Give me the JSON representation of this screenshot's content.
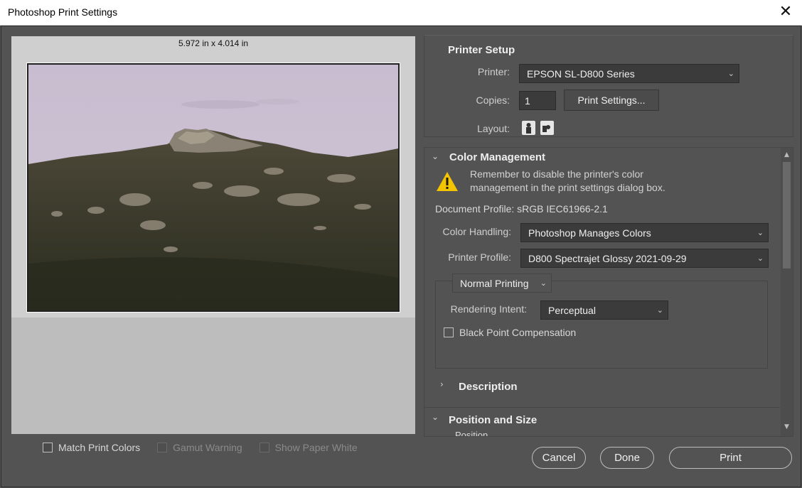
{
  "window": {
    "title": "Photoshop Print Settings",
    "close_glyph": "✕"
  },
  "preview": {
    "dimensions": "5.972 in x 4.014 in"
  },
  "bottom_checks": [
    {
      "label": "Match Print Colors",
      "checked": false,
      "enabled": true
    },
    {
      "label": "Gamut Warning",
      "checked": false,
      "enabled": false
    },
    {
      "label": "Show Paper White",
      "checked": false,
      "enabled": false
    }
  ],
  "printer_setup": {
    "heading": "Printer Setup",
    "printer_label": "Printer:",
    "printer_value": "EPSON SL-D800 Series",
    "copies_label": "Copies:",
    "copies_value": "1",
    "print_settings_button": "Print Settings...",
    "layout_label": "Layout:",
    "layout_icons": [
      "portrait-layout-icon",
      "landscape-layout-icon"
    ]
  },
  "color_management": {
    "heading": "Color Management",
    "warning_icon": "warning-triangle-icon",
    "warning_line1": "Remember to disable the printer's color",
    "warning_line2": "management in the print settings dialog box.",
    "document_profile_label": "Document Profile:",
    "document_profile_value": "sRGB IEC61966-2.1",
    "color_handling_label": "Color Handling:",
    "color_handling_value": "Photoshop Manages Colors",
    "printer_profile_label": "Printer Profile:",
    "printer_profile_value": "D800 Spectrajet Glossy 2021-09-29",
    "printing_mode_value": "Normal Printing",
    "rendering_intent_label": "Rendering Intent:",
    "rendering_intent_value": "Perceptual",
    "black_point_label": "Black Point Compensation",
    "black_point_checked": false
  },
  "description": {
    "heading": "Description"
  },
  "position_size": {
    "heading": "Position and Size",
    "sub_label": "Position"
  },
  "buttons": {
    "cancel": "Cancel",
    "done": "Done",
    "print": "Print"
  },
  "colors": {
    "dialog_bg": "#535353",
    "field_bg": "#3b3b3b",
    "warning": "#f5c400"
  }
}
